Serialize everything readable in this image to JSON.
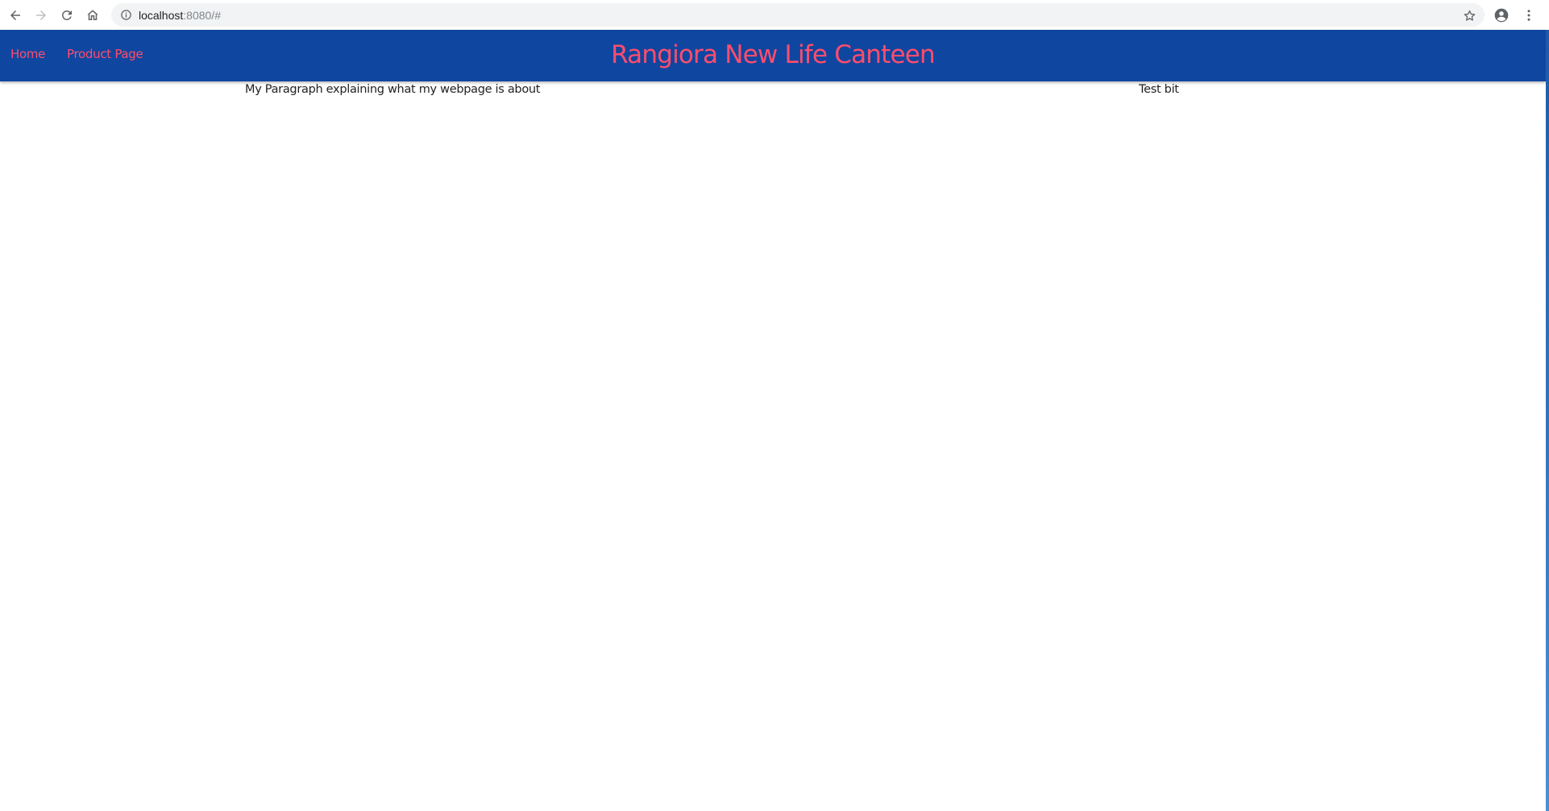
{
  "browser": {
    "url_host": "localhost",
    "url_rest": ":8080/#",
    "icons": {
      "back": "arrow-left-icon",
      "forward": "arrow-right-icon",
      "reload": "reload-icon",
      "home": "home-icon",
      "site_info": "info-icon",
      "bookmark": "star-icon",
      "profile": "account-circle-icon",
      "menu": "kebab-menu-icon"
    }
  },
  "site": {
    "title": "Rangiora New Life Canteen",
    "nav": {
      "home_label": "Home",
      "product_label": "Product Page"
    },
    "colors": {
      "header_bg": "#0f46a0",
      "accent_text": "#ff4d6d"
    }
  },
  "content": {
    "intro": "My Paragraph explaining what my webpage is about",
    "side": "Test bit"
  }
}
